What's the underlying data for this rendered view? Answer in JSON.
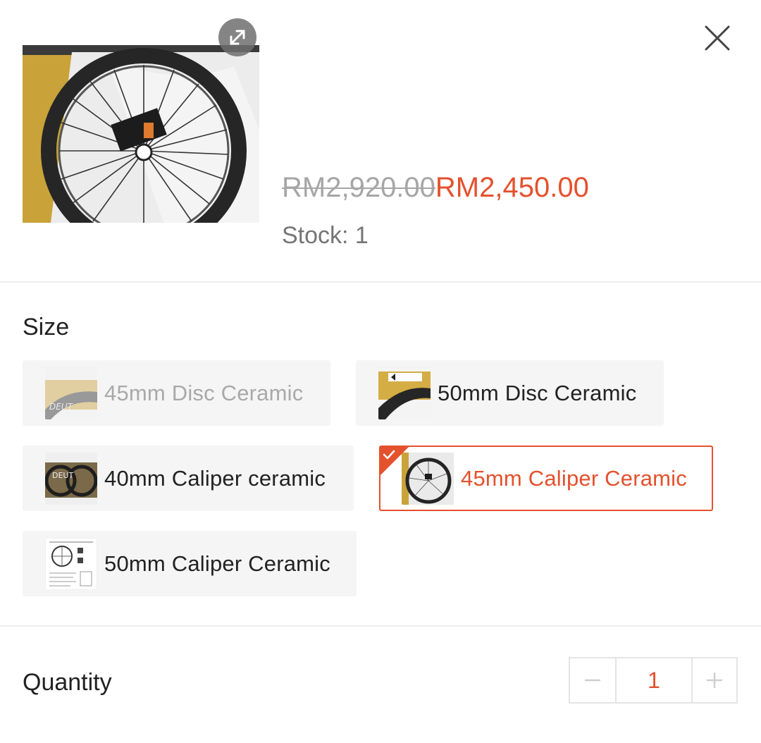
{
  "product": {
    "original_price": "RM2,920.00",
    "sale_price": "RM2,450.00",
    "stock_label": "Stock: 1"
  },
  "icons": {
    "expand": "expand-icon",
    "close": "close-icon",
    "minus": "minus-icon",
    "plus": "plus-icon",
    "check": "checkmark-icon"
  },
  "variation": {
    "title": "Size",
    "options": [
      {
        "label": "45mm Disc Ceramic",
        "state": "disabled"
      },
      {
        "label": "50mm Disc Ceramic",
        "state": "available"
      },
      {
        "label": "40mm Caliper ceramic",
        "state": "available"
      },
      {
        "label": "45mm Caliper Ceramic",
        "state": "selected"
      },
      {
        "label": "50mm Caliper Ceramic",
        "state": "available"
      }
    ]
  },
  "quantity": {
    "title": "Quantity",
    "value": "1"
  },
  "colors": {
    "accent": "#e4512d",
    "muted_text": "#a6a6a6",
    "option_bg": "#f5f5f5"
  }
}
